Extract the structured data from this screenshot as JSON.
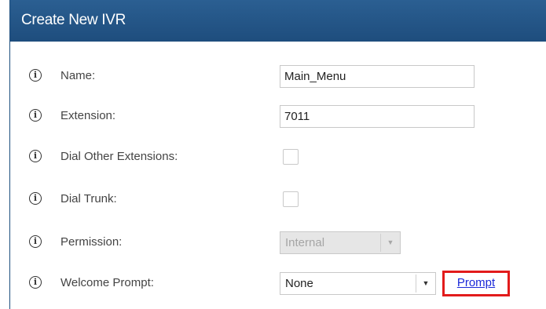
{
  "header": {
    "title": "Create New IVR"
  },
  "form": {
    "info_glyph": "i",
    "name": {
      "label": "Name:",
      "value": "Main_Menu"
    },
    "extension": {
      "label": "Extension:",
      "value": "7011"
    },
    "dial_other_extensions": {
      "label": "Dial Other Extensions:",
      "checked": false
    },
    "dial_trunk": {
      "label": "Dial Trunk:",
      "checked": false
    },
    "permission": {
      "label": "Permission:",
      "value": "Internal",
      "disabled": true
    },
    "welcome_prompt": {
      "label": "Welcome Prompt:",
      "value": "None",
      "link_label": "Prompt"
    }
  },
  "colors": {
    "header_bg": "#1e4d7d",
    "header_text": "#ffffff",
    "highlight_border": "#e21b1b",
    "link": "#1a28d8"
  },
  "icons": {
    "info": "info-circle-icon",
    "dropdown": "chevron-down-icon"
  }
}
